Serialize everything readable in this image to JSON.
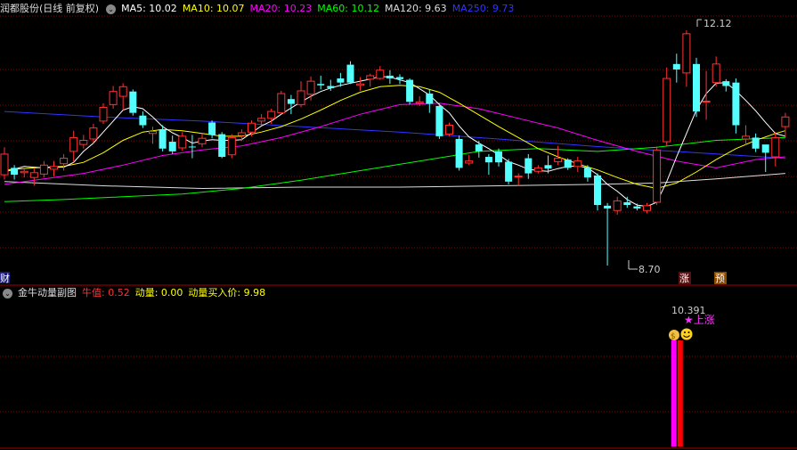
{
  "main_panel": {
    "stock_name": "润都股份",
    "mode_label": "(日线 前复权)",
    "indicators": [
      {
        "label": "MA5: ",
        "value": "10.02",
        "color": "#ffffff"
      },
      {
        "label": "MA10: ",
        "value": "10.07",
        "color": "#ffff00"
      },
      {
        "label": "MA20: ",
        "value": "10.23",
        "color": "#ff00ff"
      },
      {
        "label": "MA60: ",
        "value": "10.12",
        "color": "#00ff00"
      },
      {
        "label": "MA120: ",
        "value": "9.63",
        "color": "#dddddd"
      },
      {
        "label": "MA250: ",
        "value": "9.73",
        "color": "#3333ff"
      }
    ],
    "high_label": "12.12",
    "low_label": "8.70",
    "tag_cai": "财",
    "tag_zhang": "涨",
    "tag_yu": "预"
  },
  "sub_panel": {
    "title": "金牛动量副图",
    "items": [
      {
        "label": "牛值: ",
        "value": "0.52",
        "color": "#ff3333"
      },
      {
        "label": "动量: ",
        "value": "0.00",
        "color": "#ffff00"
      },
      {
        "label": "动量买入价: ",
        "value": "9.98",
        "color": "#ffff00"
      }
    ],
    "buy_price_label": "10.391",
    "signal_label": "★上涨"
  },
  "colors": {
    "up": "#ff3232",
    "down": "#54ffff",
    "grid": "#8b0000",
    "ma5": "#ffffff",
    "ma10": "#ffff00",
    "ma20": "#ff00ff",
    "ma60": "#00ff00",
    "ma120": "#dddddd",
    "ma250": "#3333ff"
  },
  "chart_data": {
    "type": "candlestick",
    "candles": [
      [
        10.02,
        10.32,
        10.42,
        9.95
      ],
      [
        10.12,
        10.02,
        10.16,
        9.95
      ],
      [
        10.05,
        10.07,
        10.11,
        9.98
      ],
      [
        9.98,
        10.05,
        10.12,
        9.86
      ],
      [
        10.03,
        10.16,
        10.22,
        9.98
      ],
      [
        10.1,
        10.14,
        10.22,
        10.0
      ],
      [
        10.18,
        10.26,
        10.32,
        10.08
      ],
      [
        10.36,
        10.56,
        10.66,
        10.2
      ],
      [
        10.46,
        10.52,
        10.6,
        10.4
      ],
      [
        10.54,
        10.7,
        10.76,
        10.48
      ],
      [
        10.8,
        11.0,
        11.06,
        10.76
      ],
      [
        11.04,
        11.23,
        11.31,
        10.98
      ],
      [
        11.16,
        11.3,
        11.35,
        10.96
      ],
      [
        11.23,
        10.92,
        11.26,
        10.88
      ],
      [
        10.88,
        10.74,
        10.94,
        10.7
      ],
      [
        10.62,
        10.65,
        10.72,
        10.47
      ],
      [
        10.68,
        10.4,
        10.74,
        10.36
      ],
      [
        10.5,
        10.36,
        10.59,
        10.32
      ],
      [
        10.41,
        10.58,
        10.64,
        10.37
      ],
      [
        10.43,
        10.42,
        10.6,
        10.26
      ],
      [
        10.47,
        10.55,
        10.62,
        10.42
      ],
      [
        10.78,
        10.6,
        10.81,
        10.55
      ],
      [
        10.61,
        10.28,
        10.64,
        10.26
      ],
      [
        10.31,
        10.56,
        10.61,
        10.26
      ],
      [
        10.59,
        10.63,
        10.68,
        10.51
      ],
      [
        10.64,
        10.77,
        10.81,
        10.58
      ],
      [
        10.8,
        10.84,
        10.9,
        10.74
      ],
      [
        10.84,
        10.94,
        10.98,
        10.76
      ],
      [
        10.92,
        11.2,
        11.24,
        10.9
      ],
      [
        11.12,
        11.05,
        11.18,
        10.9
      ],
      [
        11.04,
        11.24,
        11.38,
        11.0
      ],
      [
        11.19,
        11.38,
        11.45,
        11.1
      ],
      [
        11.34,
        11.32,
        11.46,
        11.26
      ],
      [
        11.31,
        11.28,
        11.4,
        11.24
      ],
      [
        11.42,
        11.36,
        11.5,
        11.3
      ],
      [
        11.62,
        11.36,
        11.67,
        11.34
      ],
      [
        11.32,
        11.34,
        11.44,
        11.24
      ],
      [
        11.41,
        11.46,
        11.49,
        11.3
      ],
      [
        11.42,
        11.54,
        11.6,
        11.4
      ],
      [
        11.46,
        11.42,
        11.54,
        11.34
      ],
      [
        11.44,
        11.41,
        11.48,
        11.34
      ],
      [
        11.4,
        11.08,
        11.42,
        11.04
      ],
      [
        11.06,
        11.08,
        11.16,
        11.02
      ],
      [
        11.2,
        11.05,
        11.26,
        10.92
      ],
      [
        11.02,
        10.58,
        11.06,
        10.54
      ],
      [
        10.61,
        10.74,
        10.78,
        10.58
      ],
      [
        10.54,
        10.12,
        10.59,
        10.08
      ],
      [
        10.19,
        10.22,
        10.31,
        10.16
      ],
      [
        10.46,
        10.36,
        10.51,
        10.27
      ],
      [
        10.28,
        10.2,
        10.32,
        10.02
      ],
      [
        10.36,
        10.2,
        10.4,
        10.14
      ],
      [
        10.21,
        9.92,
        10.25,
        9.88
      ],
      [
        10.0,
        10.0,
        10.04,
        9.86
      ],
      [
        10.26,
        10.04,
        10.32,
        9.96
      ],
      [
        10.07,
        10.12,
        10.16,
        10.04
      ],
      [
        10.16,
        10.11,
        10.3,
        10.04
      ],
      [
        10.21,
        10.26,
        10.44,
        10.16
      ],
      [
        10.24,
        10.12,
        10.26,
        10.09
      ],
      [
        10.14,
        10.22,
        10.28,
        10.06
      ],
      [
        10.12,
        9.98,
        10.16,
        9.92
      ],
      [
        10.01,
        9.58,
        10.04,
        9.5
      ],
      [
        9.57,
        9.53,
        9.61,
        8.7
      ],
      [
        9.5,
        9.64,
        9.7,
        9.44
      ],
      [
        9.62,
        9.58,
        9.7,
        9.54
      ],
      [
        9.56,
        9.53,
        9.6,
        9.5
      ],
      [
        9.5,
        9.57,
        9.61,
        9.46
      ],
      [
        9.62,
        10.38,
        10.43,
        9.58
      ],
      [
        10.5,
        11.42,
        11.58,
        10.44
      ],
      [
        11.63,
        11.55,
        11.78,
        11.36
      ],
      [
        11.5,
        12.07,
        12.12,
        11.3
      ],
      [
        11.63,
        10.94,
        11.72,
        10.86
      ],
      [
        11.08,
        11.09,
        11.53,
        10.82
      ],
      [
        11.36,
        11.63,
        11.74,
        11.3
      ],
      [
        11.38,
        11.31,
        11.41,
        11.23
      ],
      [
        11.36,
        10.74,
        11.42,
        10.62
      ],
      [
        10.54,
        10.58,
        10.74,
        10.45
      ],
      [
        10.56,
        10.4,
        10.62,
        10.35
      ],
      [
        10.46,
        10.34,
        10.4,
        10.06
      ],
      [
        10.28,
        10.56,
        10.64,
        10.14
      ],
      [
        10.72,
        10.86,
        10.92,
        10.56
      ]
    ],
    "ma5": [
      [
        0,
        10.06
      ],
      [
        1,
        10.1
      ],
      [
        2,
        10.14
      ],
      [
        3,
        10.13
      ],
      [
        4,
        10.12
      ],
      [
        5,
        10.13
      ],
      [
        6,
        10.13
      ],
      [
        7,
        10.2
      ],
      [
        8,
        10.36
      ],
      [
        9,
        10.48
      ],
      [
        10,
        10.64
      ],
      [
        11,
        10.8
      ],
      [
        12,
        10.96
      ],
      [
        13,
        11.01
      ],
      [
        14,
        10.98
      ],
      [
        15,
        10.86
      ],
      [
        16,
        10.72
      ],
      [
        17,
        10.63
      ],
      [
        18,
        10.56
      ],
      [
        19,
        10.48
      ],
      [
        20,
        10.51
      ],
      [
        21,
        10.53
      ],
      [
        22,
        10.52
      ],
      [
        23,
        10.52
      ],
      [
        24,
        10.53
      ],
      [
        25,
        10.63
      ],
      [
        26,
        10.73
      ],
      [
        27,
        10.8
      ],
      [
        28,
        10.9
      ],
      [
        29,
        10.99
      ],
      [
        30,
        11.08
      ],
      [
        31,
        11.16
      ],
      [
        32,
        11.23
      ],
      [
        33,
        11.28
      ],
      [
        34,
        11.32
      ],
      [
        35,
        11.35
      ],
      [
        36,
        11.38
      ],
      [
        37,
        11.41
      ],
      [
        38,
        11.45
      ],
      [
        39,
        11.44
      ],
      [
        40,
        11.4
      ],
      [
        41,
        11.36
      ],
      [
        42,
        11.27
      ],
      [
        43,
        11.18
      ],
      [
        44,
        11.04
      ],
      [
        45,
        10.92
      ],
      [
        46,
        10.73
      ],
      [
        47,
        10.57
      ],
      [
        48,
        10.48
      ],
      [
        49,
        10.4
      ],
      [
        50,
        10.31
      ],
      [
        51,
        10.21
      ],
      [
        52,
        10.16
      ],
      [
        53,
        10.1
      ],
      [
        54,
        10.08
      ],
      [
        55,
        10.07
      ],
      [
        56,
        10.11
      ],
      [
        57,
        10.14
      ],
      [
        58,
        10.15
      ],
      [
        59,
        10.12
      ],
      [
        60,
        10.02
      ],
      [
        61,
        9.88
      ],
      [
        62,
        9.78
      ],
      [
        63,
        9.66
      ],
      [
        64,
        9.58
      ],
      [
        65,
        9.56
      ],
      [
        66,
        9.62
      ],
      [
        67,
        9.92
      ],
      [
        68,
        10.28
      ],
      [
        69,
        10.62
      ],
      [
        70,
        10.96
      ],
      [
        71,
        11.2
      ],
      [
        72,
        11.35
      ],
      [
        73,
        11.36
      ],
      [
        74,
        11.24
      ],
      [
        75,
        11.1
      ],
      [
        76,
        10.95
      ],
      [
        77,
        10.78
      ],
      [
        78,
        10.62
      ],
      [
        79,
        10.58
      ]
    ],
    "ma10": [
      [
        0,
        10.09
      ],
      [
        3,
        10.12
      ],
      [
        6,
        10.14
      ],
      [
        8,
        10.2
      ],
      [
        10,
        10.34
      ],
      [
        12,
        10.52
      ],
      [
        14,
        10.64
      ],
      [
        16,
        10.68
      ],
      [
        18,
        10.66
      ],
      [
        20,
        10.62
      ],
      [
        22,
        10.58
      ],
      [
        24,
        10.58
      ],
      [
        26,
        10.64
      ],
      [
        28,
        10.72
      ],
      [
        30,
        10.83
      ],
      [
        32,
        10.96
      ],
      [
        34,
        11.1
      ],
      [
        36,
        11.22
      ],
      [
        38,
        11.3
      ],
      [
        40,
        11.32
      ],
      [
        42,
        11.3
      ],
      [
        44,
        11.22
      ],
      [
        46,
        11.06
      ],
      [
        48,
        10.89
      ],
      [
        50,
        10.72
      ],
      [
        52,
        10.56
      ],
      [
        54,
        10.4
      ],
      [
        56,
        10.28
      ],
      [
        58,
        10.18
      ],
      [
        60,
        10.09
      ],
      [
        62,
        9.98
      ],
      [
        64,
        9.88
      ],
      [
        66,
        9.82
      ],
      [
        68,
        9.9
      ],
      [
        70,
        10.06
      ],
      [
        72,
        10.24
      ],
      [
        74,
        10.4
      ],
      [
        76,
        10.52
      ],
      [
        78,
        10.62
      ],
      [
        79,
        10.66
      ]
    ],
    "ma20": [
      [
        0,
        9.88
      ],
      [
        4,
        9.96
      ],
      [
        8,
        10.04
      ],
      [
        12,
        10.16
      ],
      [
        16,
        10.3
      ],
      [
        20,
        10.38
      ],
      [
        24,
        10.44
      ],
      [
        28,
        10.56
      ],
      [
        32,
        10.72
      ],
      [
        36,
        10.9
      ],
      [
        40,
        11.04
      ],
      [
        44,
        11.06
      ],
      [
        48,
        10.98
      ],
      [
        52,
        10.84
      ],
      [
        56,
        10.7
      ],
      [
        60,
        10.52
      ],
      [
        64,
        10.36
      ],
      [
        68,
        10.22
      ],
      [
        72,
        10.12
      ],
      [
        76,
        10.24
      ],
      [
        79,
        10.28
      ]
    ],
    "ma60": [
      [
        0,
        9.63
      ],
      [
        6,
        9.66
      ],
      [
        12,
        9.7
      ],
      [
        18,
        9.74
      ],
      [
        24,
        9.82
      ],
      [
        30,
        9.94
      ],
      [
        36,
        10.08
      ],
      [
        42,
        10.22
      ],
      [
        48,
        10.36
      ],
      [
        54,
        10.4
      ],
      [
        60,
        10.36
      ],
      [
        66,
        10.42
      ],
      [
        72,
        10.52
      ],
      [
        79,
        10.56
      ]
    ],
    "ma120": [
      [
        0,
        9.92
      ],
      [
        10,
        9.86
      ],
      [
        20,
        9.82
      ],
      [
        30,
        9.84
      ],
      [
        40,
        9.84
      ],
      [
        50,
        9.86
      ],
      [
        60,
        9.88
      ],
      [
        66,
        9.9
      ],
      [
        72,
        9.96
      ],
      [
        79,
        10.04
      ]
    ],
    "ma250": [
      [
        0,
        10.94
      ],
      [
        10,
        10.86
      ],
      [
        20,
        10.8
      ],
      [
        30,
        10.72
      ],
      [
        40,
        10.64
      ],
      [
        50,
        10.54
      ],
      [
        60,
        10.43
      ],
      [
        70,
        10.34
      ],
      [
        79,
        10.26
      ]
    ],
    "sub_bars": [
      {
        "index": 67,
        "color": "#ff00ff"
      },
      {
        "index": 68,
        "color": "#ff0000"
      }
    ]
  }
}
